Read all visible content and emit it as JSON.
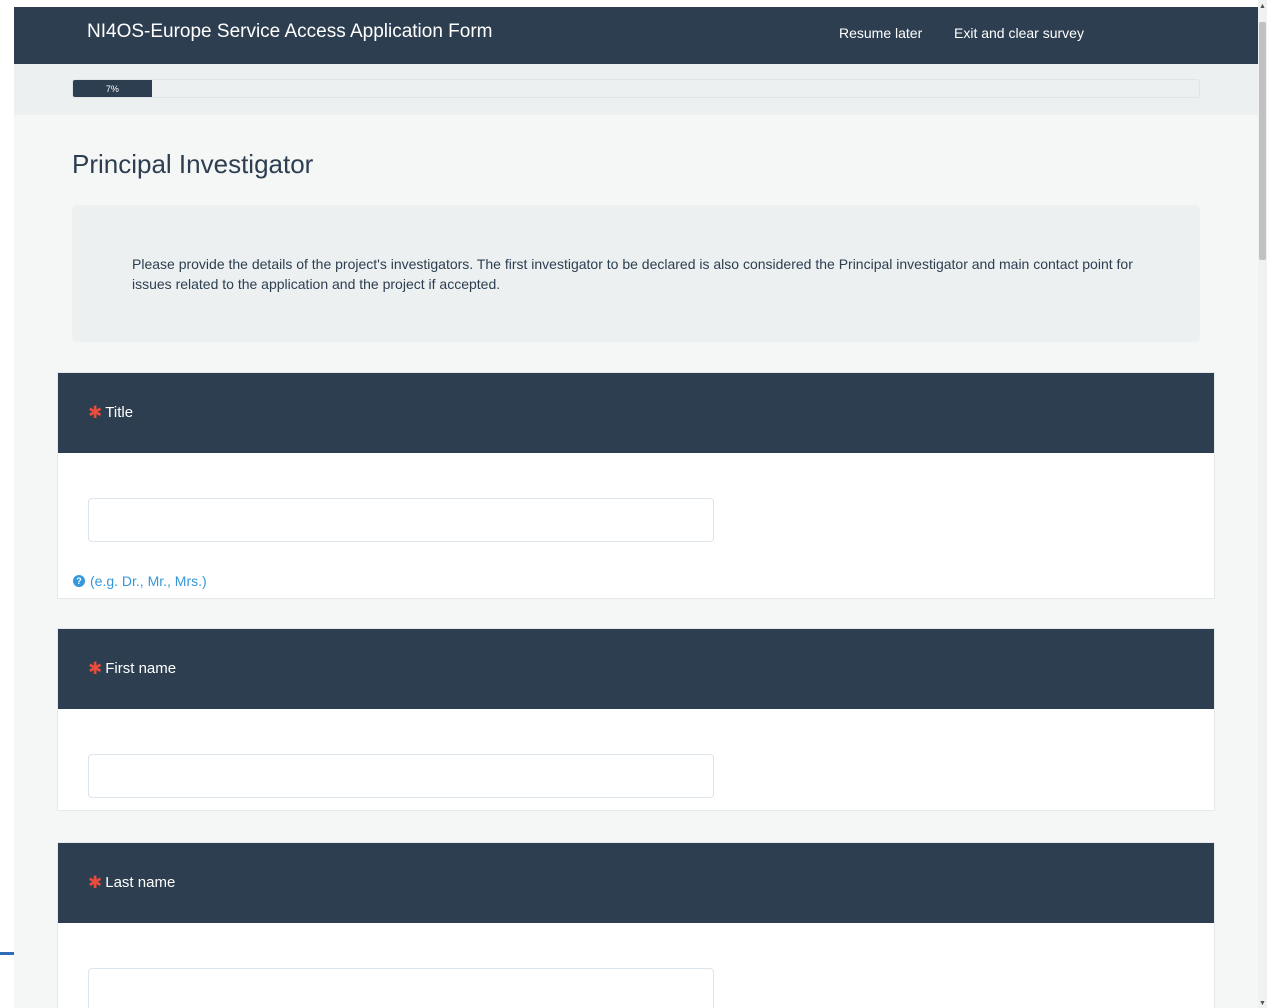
{
  "header": {
    "brand": "NI4OS-Europe Service Access Application Form",
    "resume_later": "Resume later",
    "exit_clear": "Exit and clear survey"
  },
  "progress": {
    "percent": 7,
    "label": "7%"
  },
  "group": {
    "title": "Principal Investigator",
    "description": "Please provide the details of the project's investigators. The first investigator to be declared is also considered the Principal investigator and main contact point for issues related to the application and the project if accepted."
  },
  "questions": [
    {
      "label": "Title",
      "required_mark": "✱",
      "value": "",
      "help": "(e.g. Dr., Mr., Mrs.)"
    },
    {
      "label": "First name",
      "required_mark": "✱",
      "value": ""
    },
    {
      "label": "Last name",
      "required_mark": "✱",
      "value": ""
    }
  ],
  "icons": {
    "help": "question-circle-icon",
    "required": "asterisk-icon"
  },
  "colors": {
    "navbar": "#2c3e50",
    "required": "#e74c3c",
    "help": "#3498db"
  }
}
